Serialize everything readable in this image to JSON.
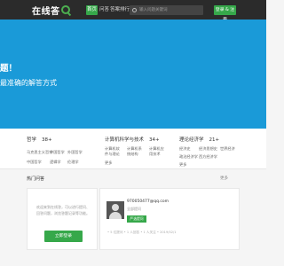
{
  "header": {
    "logo_text": "在线答",
    "tabs": [
      {
        "label": "首页",
        "active": true
      },
      {
        "label": "问答",
        "active": false
      },
      {
        "label": "答案排行",
        "active": false
      }
    ],
    "search_placeholder": "输入问题关键词",
    "auth_label": "登录 & 注册"
  },
  "hero": {
    "headline": "题！",
    "subline": "最准确的解答方式"
  },
  "categories": [
    {
      "title": "哲学",
      "count": "38+",
      "items": [
        "马克思主义哲学",
        "中国哲学",
        "外国哲学",
        "中国哲学",
        "逻辑学",
        "伦理学"
      ]
    },
    {
      "title": "计算机科学与技术",
      "count": "34+",
      "items": [
        "计算机软件与理论",
        "计算机系统结构",
        "计算机应用技术",
        "更多"
      ]
    },
    {
      "title": "理论经济学",
      "count": "21+",
      "items": [
        "经济史",
        "经济思想史",
        "世界经济",
        "政治经济学",
        "西方经济学",
        "更多"
      ]
    }
  ],
  "section": {
    "title": "热门问答",
    "more": "更多"
  },
  "login_card": {
    "text": "欢迎来到在线答，可以进行提问、回答问题，浏览答题记录等功能。",
    "button": "立即登录"
  },
  "profile_card": {
    "email": "970050477@qq.com",
    "status": "全部提问",
    "badge": "严选提问",
    "stats": "• 5 位提问 • 1 人回答 • 1 人关注 • 2019/02/1"
  },
  "colors": {
    "nav_bg": "#2b2b2b",
    "hero_bg": "#1a9ad8",
    "accent": "#36a84a"
  }
}
